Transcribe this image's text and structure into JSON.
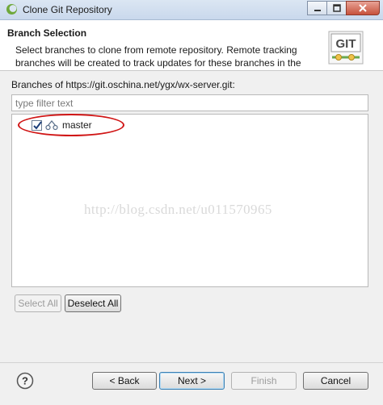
{
  "window": {
    "title": "Clone Git Repository",
    "controls": [
      "minimize",
      "maximize",
      "close"
    ]
  },
  "header": {
    "title": "Branch Selection",
    "description": "Select branches to clone from remote repository. Remote tracking branches will be created to track updates for these branches in the",
    "logo_text": "GIT"
  },
  "branches": {
    "label": "Branches of https://git.oschina.net/ygx/wx-server.git:",
    "filter_placeholder": "type filter text",
    "items": [
      {
        "name": "master",
        "checked": true
      }
    ]
  },
  "watermark": "http://blog.csdn.net/u011570965",
  "buttons": {
    "select_all": "Select All",
    "deselect_all": "Deselect All",
    "back": "< Back",
    "next": "Next >",
    "finish": "Finish",
    "cancel": "Cancel"
  },
  "colors": {
    "annotation": "#d01414",
    "title_bar": "#c9d8ec",
    "logo_green": "#6aa84f"
  }
}
